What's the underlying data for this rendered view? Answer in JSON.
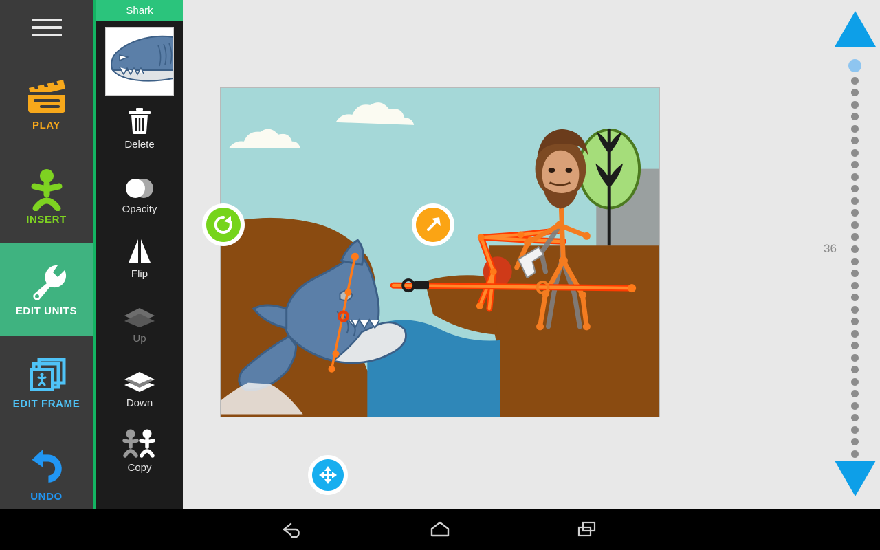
{
  "app": {
    "accent_green": "#14b463",
    "panel_dark": "#1c1c1c",
    "rail_dark": "#3b3b3b",
    "workspace_bg": "#e8e8e8"
  },
  "rail": {
    "menu_icon": "hamburger-menu-icon",
    "items": [
      {
        "label": "PLAY",
        "icon": "clapperboard-icon",
        "color": "#f7a81b",
        "active": false
      },
      {
        "label": "INSERT",
        "icon": "stick-figure-icon",
        "color": "#7ed321",
        "active": false
      },
      {
        "label": "EDIT UNITS",
        "icon": "wrench-icon",
        "color": "#ffffff",
        "active": true
      },
      {
        "label": "EDIT FRAME",
        "icon": "frames-icon",
        "color": "#4fc3f7",
        "active": false
      },
      {
        "label": "UNDO",
        "icon": "undo-arrow-icon",
        "color": "#2196f3",
        "active": false
      }
    ]
  },
  "unit_panel": {
    "title": "Shark",
    "thumbnail_alt": "shark-thumbnail",
    "tools": [
      {
        "label": "Delete",
        "icon": "trash-icon",
        "enabled": true
      },
      {
        "label": "Opacity",
        "icon": "opacity-circles-icon",
        "enabled": true
      },
      {
        "label": "Flip",
        "icon": "flip-horizontal-icon",
        "enabled": true
      },
      {
        "label": "Up",
        "icon": "layer-up-icon",
        "enabled": false
      },
      {
        "label": "Down",
        "icon": "layer-down-icon",
        "enabled": true
      },
      {
        "label": "Copy",
        "icon": "copy-figures-icon",
        "enabled": true
      }
    ]
  },
  "canvas": {
    "handles": [
      {
        "name": "rotate",
        "icon": "rotate-arrow-icon",
        "color": "#76d41b"
      },
      {
        "name": "scale",
        "icon": "diagonal-arrow-icon",
        "color": "#fba414"
      },
      {
        "name": "move",
        "icon": "move-cross-arrows-icon",
        "color": "#17aeef"
      }
    ],
    "scene": {
      "sky_color": "#a5d8d8",
      "cloud_color": "#fbfbf2",
      "cliff_color": "#8a4b11",
      "water_color": "#2f87b8",
      "shark_body": "#5b7fa8",
      "shark_belly": "#e3e6e8",
      "tree_leaf": "#a5dd7a",
      "tree_outline": "#4c7a20",
      "rig_color": "#ff7a18",
      "rig_red": "#f03c12",
      "building_gray": "#9aa0a0"
    }
  },
  "frame_slider": {
    "up_arrow": "triangle-up-icon",
    "down_arrow": "triangle-down-icon",
    "current_frame": "36",
    "total_dots": 33,
    "current_dot_index": 0
  },
  "android_nav": {
    "buttons": [
      {
        "name": "back",
        "icon": "back-arrow-icon"
      },
      {
        "name": "home",
        "icon": "home-icon"
      },
      {
        "name": "recent",
        "icon": "recent-apps-icon"
      }
    ]
  }
}
